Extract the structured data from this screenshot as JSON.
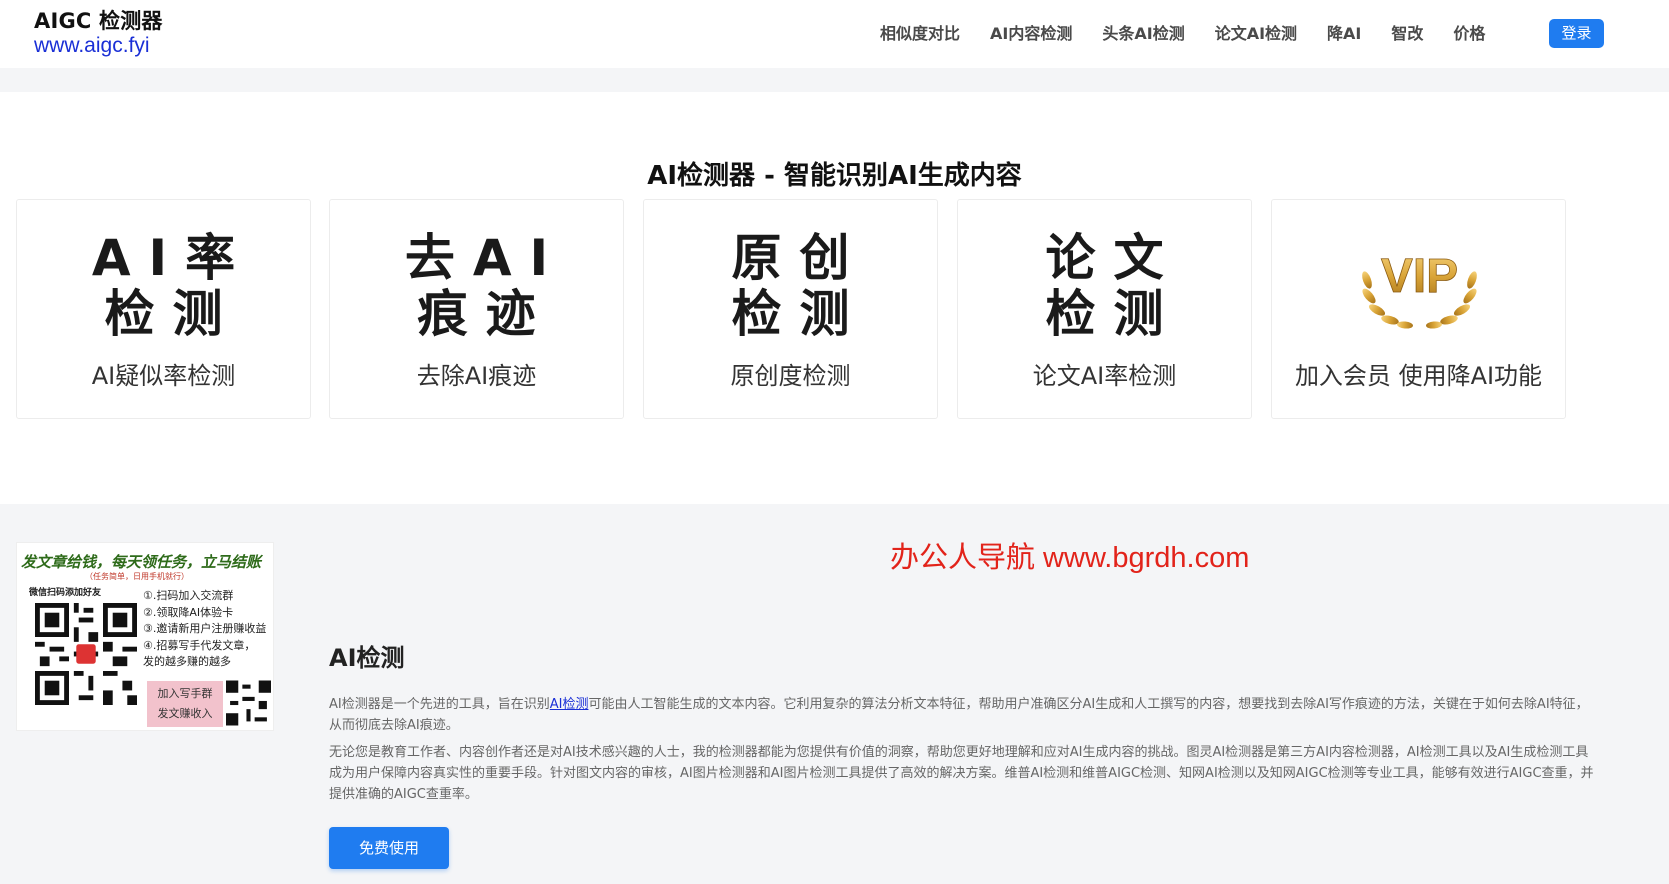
{
  "header": {
    "brand_name": "AIGC 检测器",
    "brand_url": "www.aigc.fyi",
    "nav": [
      "相似度对比",
      "AI内容检测",
      "头条AI检测",
      "论文AI检测",
      "降AI",
      "智改",
      "价格"
    ],
    "login_label": "登录"
  },
  "hero": {
    "title": "AI检测器 - 智能识别AI生成内容",
    "cards": [
      {
        "big_line1": "AI率",
        "big_line2": "检测",
        "label": "AI疑似率检测"
      },
      {
        "big_line1": "去AI",
        "big_line2": "痕迹",
        "label": "去除AI痕迹"
      },
      {
        "big_line1": "原创",
        "big_line2": "检测",
        "label": "原创度检测"
      },
      {
        "big_line1": "论文",
        "big_line2": "检测",
        "label": "论文AI率检测"
      },
      {
        "vip_text": "VIP",
        "label": "加入会员 使用降AI功能"
      }
    ]
  },
  "promo": {
    "headline": "发文章给钱，每天领任务，立马结账",
    "subline": "（任务简单，日用手机就行）",
    "scan_text": "微信扫码添加好友",
    "list": [
      "①.扫码加入交流群",
      "②.领取降AI体验卡",
      "③.邀请新用户注册赚收益",
      "④.招募写手代发文章，",
      "发的越多赚的越多"
    ],
    "pink_line1": "加入写手群",
    "pink_line2": "发文赚收入"
  },
  "watermark": "办公人导航 www.bgrdh.com",
  "about": {
    "title": "AI检测",
    "para1_before": "AI检测器是一个先进的工具，旨在识别",
    "para1_link": "AI检测",
    "para1_after": "可能由人工智能生成的文本内容。它利用复杂的算法分析文本特征，帮助用户准确区分AI生成和人工撰写的内容，想要找到去除AI写作痕迹的方法，关键在于如何去除AI特征，从而彻底去除AI痕迹。",
    "para2": "无论您是教育工作者、内容创作者还是对AI技术感兴趣的人士，我的检测器都能为您提供有价值的洞察，帮助您更好地理解和应对AI生成内容的挑战。图灵AI检测器是第三方AI内容检测器，AI检测工具以及AI生成检测工具成为用户保障内容真实性的重要手段。针对图文内容的审核，AI图片检测器和AI图片检测工具提供了高效的解决方案。维普AI检测和维普AIGC检测、知网AI检测以及知网AIGC检测等专业工具，能够有效进行AIGC查重，并提供准确的AIGC查重率。",
    "cta_label": "免费使用"
  },
  "colors": {
    "accent": "#1f7cf0",
    "link": "#1a2fd6",
    "watermark": "#e2231a",
    "section_bg": "#f4f5f7"
  }
}
